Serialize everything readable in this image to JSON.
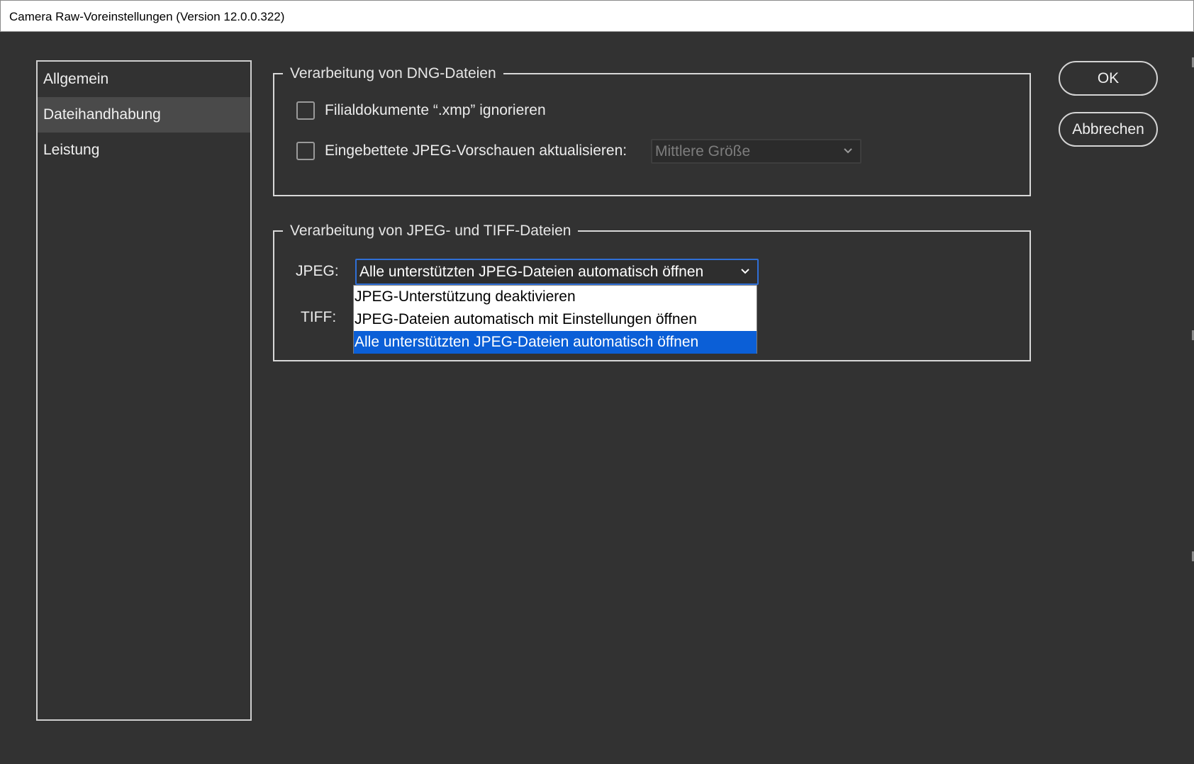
{
  "window": {
    "title": "Camera Raw-Voreinstellungen  (Version 12.0.0.322)"
  },
  "sidebar": {
    "items": [
      {
        "label": "Allgemein",
        "selected": false
      },
      {
        "label": "Dateihandhabung",
        "selected": true
      },
      {
        "label": "Leistung",
        "selected": false
      }
    ]
  },
  "dng_group": {
    "legend": "Verarbeitung von DNG-Dateien",
    "ignore_xmp": {
      "label": "Filialdokumente “.xmp” ignorieren",
      "checked": false
    },
    "update_previews": {
      "label": "Eingebettete JPEG-Vorschauen aktualisieren:",
      "checked": false
    },
    "preview_size": {
      "value": "Mittlere Größe",
      "enabled": false
    }
  },
  "jpeg_tiff_group": {
    "legend": "Verarbeitung von JPEG- und TIFF-Dateien",
    "jpeg_label": "JPEG:",
    "tiff_label": "TIFF:",
    "jpeg_select_value": "Alle unterstützten JPEG-Dateien automatisch öffnen",
    "jpeg_options": [
      "JPEG-Unterstützung deaktivieren",
      "JPEG-Dateien automatisch mit Einstellungen öffnen",
      "Alle unterstützten JPEG-Dateien automatisch öffnen"
    ],
    "jpeg_selected_index": 2
  },
  "buttons": {
    "ok": "OK",
    "cancel": "Abbrechen"
  },
  "colors": {
    "background": "#323232",
    "accent": "#0b5fd7",
    "focus_border": "#2f6fd6"
  }
}
